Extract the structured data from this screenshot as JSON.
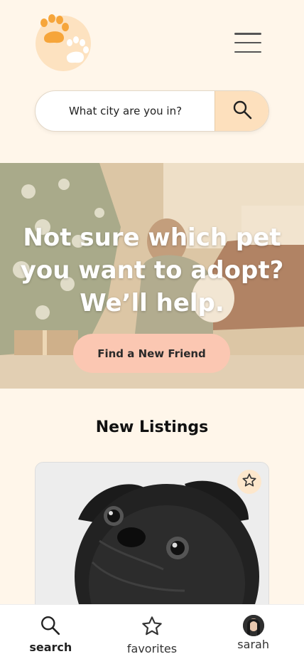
{
  "search": {
    "placeholder": "What city are you in?",
    "value": ""
  },
  "hero": {
    "title": "Not sure which pet you want to adopt? We’ll help.",
    "cta_label": "Find a New Friend"
  },
  "listings": {
    "title": "New Listings"
  },
  "nav": {
    "items": [
      {
        "label": "search",
        "icon": "search-icon",
        "active": true
      },
      {
        "label": "favorites",
        "icon": "star-icon",
        "active": false
      },
      {
        "label": "sarah",
        "icon": "avatar",
        "active": false
      }
    ]
  },
  "colors": {
    "background": "#fff6ea",
    "accent": "#fde0bd",
    "cta": "#fbc7b2",
    "paw": "#f6a53a"
  }
}
